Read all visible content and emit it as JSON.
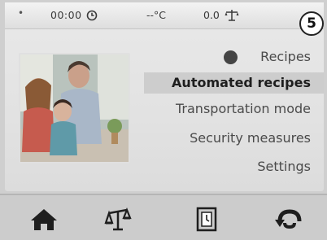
{
  "status": {
    "dot": "•",
    "time": "00:00",
    "temperature": "--°C",
    "weight": "0.0"
  },
  "step_marker": "5",
  "menu": {
    "items": [
      {
        "label": "Recipes",
        "icon": "recipes-icon"
      },
      {
        "label": "Automated recipes",
        "selected": true
      },
      {
        "label": "Transportation mode"
      },
      {
        "label": "Security measures"
      },
      {
        "label": "Settings"
      }
    ]
  },
  "bottom_nav": [
    {
      "icon": "home-icon"
    },
    {
      "icon": "scale-icon"
    },
    {
      "icon": "timer-icon"
    },
    {
      "icon": "reverse-icon"
    }
  ],
  "colors": {
    "screen_bg": "#e6e6e6",
    "selected_bg": "#cdcdcd",
    "text": "#4a4a4a",
    "bottom_bar": "#cccccc"
  }
}
